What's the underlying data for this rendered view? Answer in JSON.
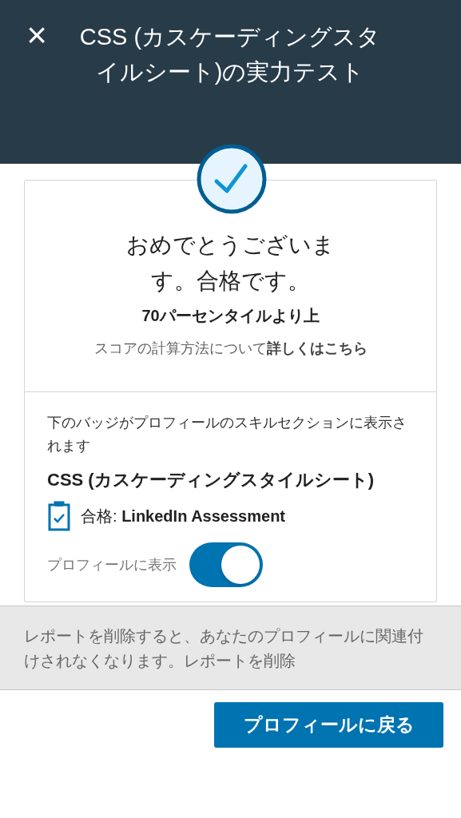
{
  "header": {
    "close_glyph": "×",
    "title": "CSS (カスケーディングスタイルシート)の実力テスト"
  },
  "result": {
    "passed": true,
    "heading": "おめでとうございます。合格です。",
    "percentile": "70パーセンタイルより上",
    "note": "スコアの計算方法について",
    "link": "詳しくはこちら"
  },
  "badge": {
    "intro": "下のバッジがプロフィールのスキルセクションに表示されます",
    "skill": "CSS (カスケーディングスタイルシート)",
    "status_label": "合格:",
    "status_value": "LinkedIn Assessment",
    "toggle_label": "プロフィールに表示",
    "on": true
  },
  "footer_note": "レポートを削除すると、あなたのプロフィールに関連付けされなくなります。レポートを削除",
  "button": "プロフィールに戻る"
}
